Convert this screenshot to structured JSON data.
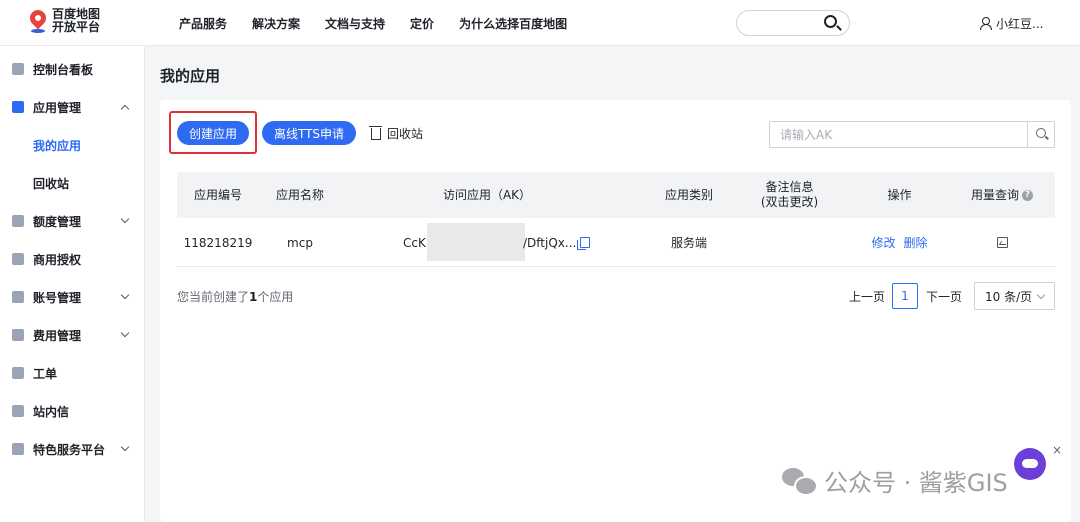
{
  "header": {
    "logo_line1": "百度地图",
    "logo_line2": "开放平台",
    "nav": [
      "产品服务",
      "解决方案",
      "文档与支持",
      "定价",
      "为什么选择百度地图"
    ],
    "user": "小红豆..."
  },
  "sidebar": {
    "items": [
      {
        "label": "控制台看板"
      },
      {
        "label": "应用管理"
      },
      {
        "label": "我的应用"
      },
      {
        "label": "回收站"
      },
      {
        "label": "额度管理"
      },
      {
        "label": "商用授权"
      },
      {
        "label": "账号管理"
      },
      {
        "label": "费用管理"
      },
      {
        "label": "工单"
      },
      {
        "label": "站内信"
      },
      {
        "label": "特色服务平台"
      }
    ]
  },
  "main": {
    "title": "我的应用",
    "create_button": "创建应用",
    "tts_button": "离线TTS申请",
    "recycle": "回收站",
    "search_placeholder": "请输入AK",
    "table": {
      "headers": [
        "应用编号",
        "应用名称",
        "访问应用（AK）",
        "应用类别",
        "备注信息",
        "(双击更改)",
        "操作",
        "用量查询"
      ],
      "row": {
        "id": "118218219",
        "name": "mcp",
        "ak_prefix": "CcKL",
        "ak_suffix": "/DftjQx...",
        "category": "服务端",
        "note": "",
        "edit": "修改",
        "delete": "删除"
      }
    },
    "summary_pre": "您当前创建了",
    "summary_count": "1",
    "summary_post": "个应用",
    "pager": {
      "prev": "上一页",
      "current": "1",
      "next": "下一页",
      "page_size": "10 条/页"
    }
  },
  "watermark": "公众号 · 酱紫GIS",
  "colors": {
    "accent": "#2f6bf2",
    "highlight": "#e0303a"
  }
}
